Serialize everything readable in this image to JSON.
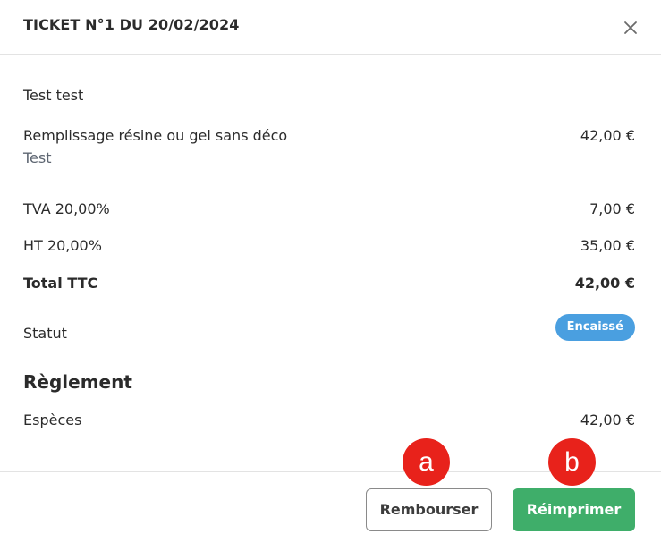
{
  "header": {
    "title": "TICKET N°1 DU 20/02/2024"
  },
  "ticket": {
    "client": "Test test",
    "item": {
      "name": "Remplissage résine ou gel sans déco",
      "price": "42,00 €",
      "staff": "Test"
    },
    "tva_label": "TVA 20,00%",
    "tva_value": "7,00 €",
    "ht_label": "HT 20,00%",
    "ht_value": "35,00 €",
    "total_label": "Total TTC",
    "total_value": "42,00 €",
    "status_label": "Statut",
    "status_badge": "Encaissé",
    "status_color": "#4a9fe0"
  },
  "payment": {
    "section_title": "Règlement",
    "method": "Espèces",
    "amount": "42,00 €"
  },
  "footer": {
    "refund_label": "Rembourser",
    "reprint_label": "Réimprimer",
    "reprint_color": "#3fae6a"
  },
  "markers": {
    "a": "a",
    "b": "b",
    "color": "#e8221b"
  },
  "icons": {
    "close": "close-icon"
  }
}
